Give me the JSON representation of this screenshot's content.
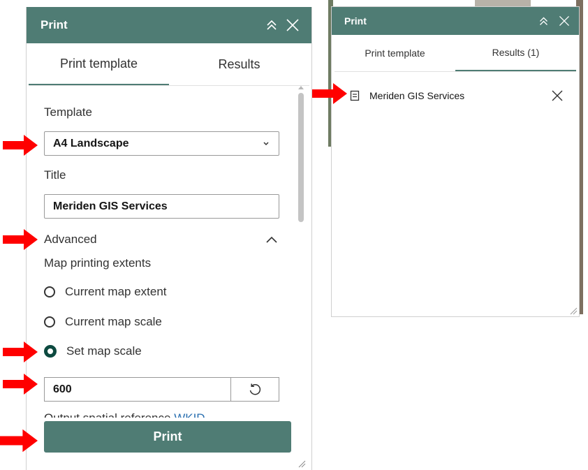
{
  "left_panel": {
    "title": "Print",
    "tabs": [
      {
        "label": "Print template",
        "active": true
      },
      {
        "label": "Results",
        "active": false
      }
    ],
    "template_label": "Template",
    "template_value": "A4 Landscape",
    "title_label": "Title",
    "title_value": "Meriden GIS Services",
    "advanced_label": "Advanced",
    "extents_label": "Map printing extents",
    "radio_options": [
      {
        "label": "Current map extent",
        "checked": false
      },
      {
        "label": "Current map scale",
        "checked": false
      },
      {
        "label": "Set map scale",
        "checked": true
      }
    ],
    "scale_value": "600",
    "output_sr_label": "Output spatial reference",
    "output_sr_link": "WKID",
    "print_button": "Print"
  },
  "right_panel": {
    "title": "Print",
    "tabs": [
      {
        "label": "Print template",
        "active": false
      },
      {
        "label": "Results (1)",
        "active": true
      }
    ],
    "result_item": "Meriden GIS Services"
  },
  "colors": {
    "header": "#4f7c74",
    "accent": "#0d4a40",
    "arrow": "#ff0000",
    "link": "#2a6fb0"
  },
  "icons": {
    "collapse": "double-chevron-up-icon",
    "close": "close-icon",
    "dropdown": "chevron-down-icon",
    "reset": "reset-icon",
    "document": "document-icon"
  }
}
